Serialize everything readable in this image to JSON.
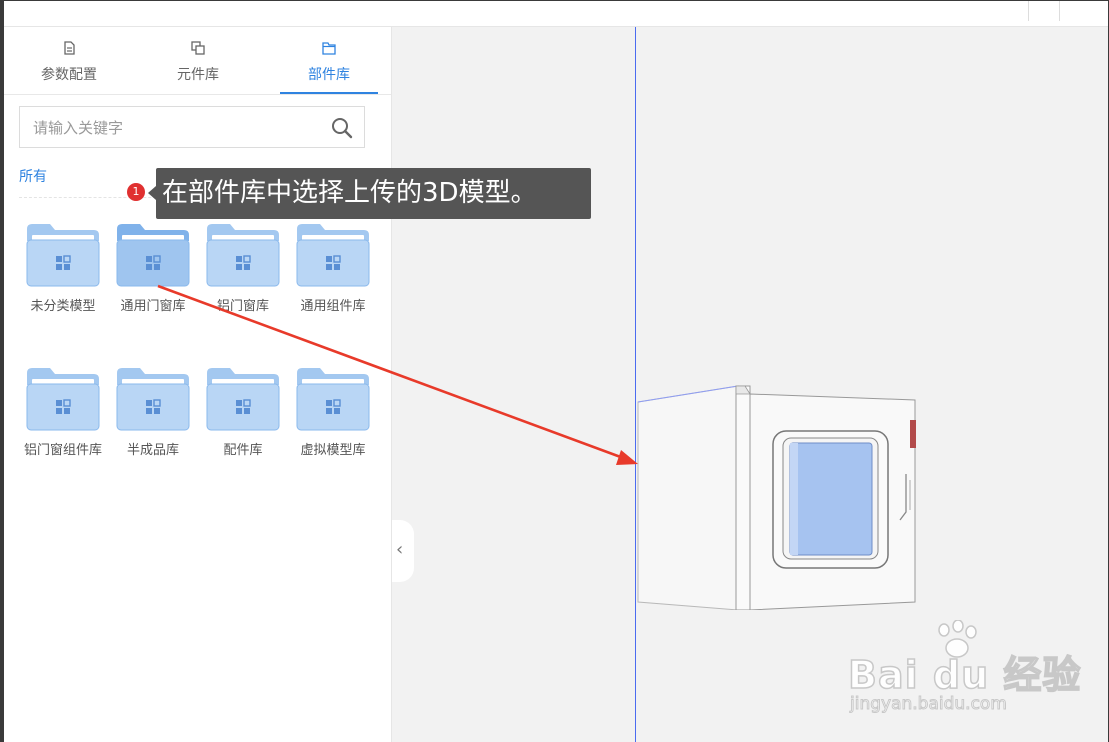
{
  "tabs": [
    {
      "label": "参数配置",
      "icon": "document-icon",
      "active": false
    },
    {
      "label": "元件库",
      "icon": "copy-icon",
      "active": false
    },
    {
      "label": "部件库",
      "icon": "folder-icon",
      "active": true
    }
  ],
  "search": {
    "placeholder": "请输入关键字",
    "value": ""
  },
  "filter": {
    "all_label": "所有"
  },
  "folders": [
    {
      "label": "未分类模型"
    },
    {
      "label": "通用门窗库"
    },
    {
      "label": "铝门窗库"
    },
    {
      "label": "通用组件库"
    },
    {
      "label": "铝门窗组件库"
    },
    {
      "label": "半成品库"
    },
    {
      "label": "配件库"
    },
    {
      "label": "虚拟模型库"
    }
  ],
  "callout": {
    "number": "1",
    "text": "在部件库中选择上传的3D模型。"
  },
  "collapse_label": "‹",
  "watermark": {
    "brand": "Bai du 经验",
    "url": "jingyan.baidu.com"
  },
  "colors": {
    "accent": "#2f83e0",
    "folder": "#b9d6f5",
    "callout_bg": "#555555",
    "arrow": "#e83a2a",
    "canvas": "#f2f2f2"
  }
}
